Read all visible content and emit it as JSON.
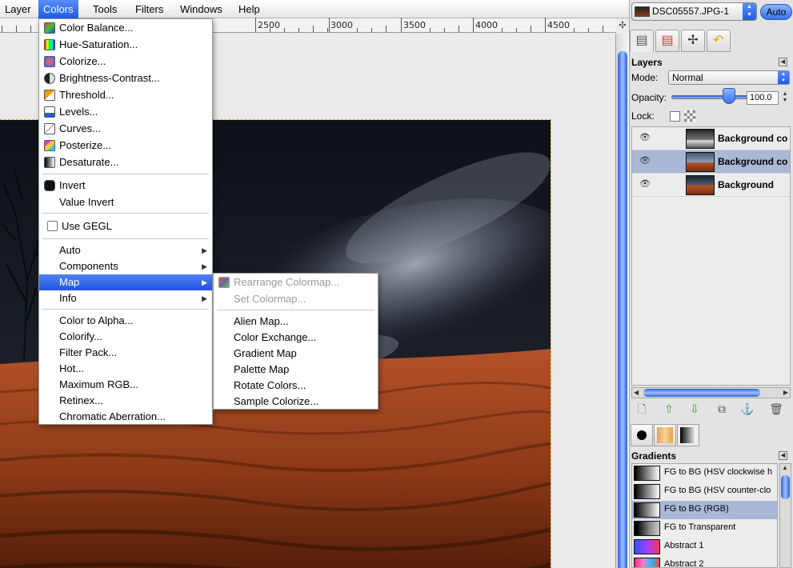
{
  "menubar": {
    "items": [
      "Layer",
      "Colors",
      "Tools",
      "Filters",
      "Windows",
      "Help"
    ]
  },
  "ruler": {
    "labels": [
      "2500",
      "3000",
      "3500",
      "4000",
      "4500"
    ]
  },
  "colors_menu": {
    "items": [
      "Color Balance...",
      "Hue-Saturation...",
      "Colorize...",
      "Brightness-Contrast...",
      "Threshold...",
      "Levels...",
      "Curves...",
      "Posterize...",
      "Desaturate...",
      "Invert",
      "Value Invert",
      "Use GEGL",
      "Auto",
      "Components",
      "Map",
      "Info",
      "Color to Alpha...",
      "Colorify...",
      "Filter Pack...",
      "Hot...",
      "Maximum RGB...",
      "Retinex...",
      "Chromatic Aberration..."
    ],
    "selected": "Map"
  },
  "map_submenu": {
    "items": [
      "Rearrange Colormap...",
      "Set Colormap...",
      "Alien Map...",
      "Color Exchange...",
      "Gradient Map",
      "Palette Map",
      "Rotate Colors...",
      "Sample Colorize..."
    ],
    "disabled": [
      "Rearrange Colormap...",
      "Set Colormap..."
    ]
  },
  "dock": {
    "image_name": "DSC05557.JPG-1",
    "auto_label": "Auto",
    "layers_title": "Layers",
    "mode_label": "Mode:",
    "mode_value": "Normal",
    "opacity_label": "Opacity:",
    "opacity_value": "100.0",
    "opacity": 1.0,
    "lock_label": "Lock:",
    "layers": [
      {
        "name": "Background co"
      },
      {
        "name": "Background co"
      },
      {
        "name": "Background"
      }
    ],
    "selected_layer": 1,
    "gradients_title": "Gradients",
    "gradients": [
      {
        "name": "FG to BG (HSV clockwise h"
      },
      {
        "name": "FG to BG (HSV counter-clo"
      },
      {
        "name": "FG to BG (RGB)"
      },
      {
        "name": "FG to Transparent"
      },
      {
        "name": "Abstract 1"
      },
      {
        "name": "Abstract 2"
      }
    ],
    "selected_gradient": 2
  },
  "colors": {
    "accent": "#2155dd",
    "selection_row": "#a8b8d6",
    "sand": "#a8421c",
    "sky": "#14171e"
  }
}
